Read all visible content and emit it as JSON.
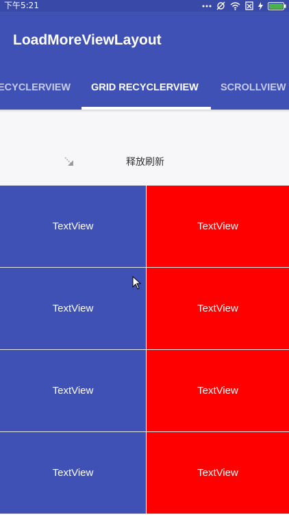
{
  "status_bar": {
    "time": "下午5:21",
    "icons": [
      "more-dots-icon",
      "sync-off-icon",
      "wifi-icon",
      "sim-off-icon",
      "charging-icon",
      "battery-icon"
    ],
    "background": "#3949a8"
  },
  "app_bar": {
    "title": "LoadMoreViewLayout",
    "background": "#3f51b5",
    "tabs": [
      {
        "label": "RECYCLERVIEW",
        "visible_text": "ECYCLERVIEW",
        "active": false
      },
      {
        "label": "GRID RECYCLERVIEW",
        "visible_text": "GRID RECYCLERVIEW",
        "active": true
      },
      {
        "label": "SCROLLVIEW",
        "visible_text": "SCROLLVIEW",
        "active": false
      }
    ]
  },
  "refresh_header": {
    "text": "释放刷新",
    "icon": "pull-arrow-icon"
  },
  "grid": {
    "items": [
      {
        "text": "TextView",
        "color": "#3f51b5"
      },
      {
        "text": "TextView",
        "color": "#ff0000"
      },
      {
        "text": "TextView",
        "color": "#3f51b5"
      },
      {
        "text": "TextView",
        "color": "#ff0000"
      },
      {
        "text": "TextView",
        "color": "#3f51b5"
      },
      {
        "text": "TextView",
        "color": "#ff0000"
      },
      {
        "text": "TextView",
        "color": "#3f51b5"
      },
      {
        "text": "TextView",
        "color": "#ff0000"
      }
    ]
  }
}
